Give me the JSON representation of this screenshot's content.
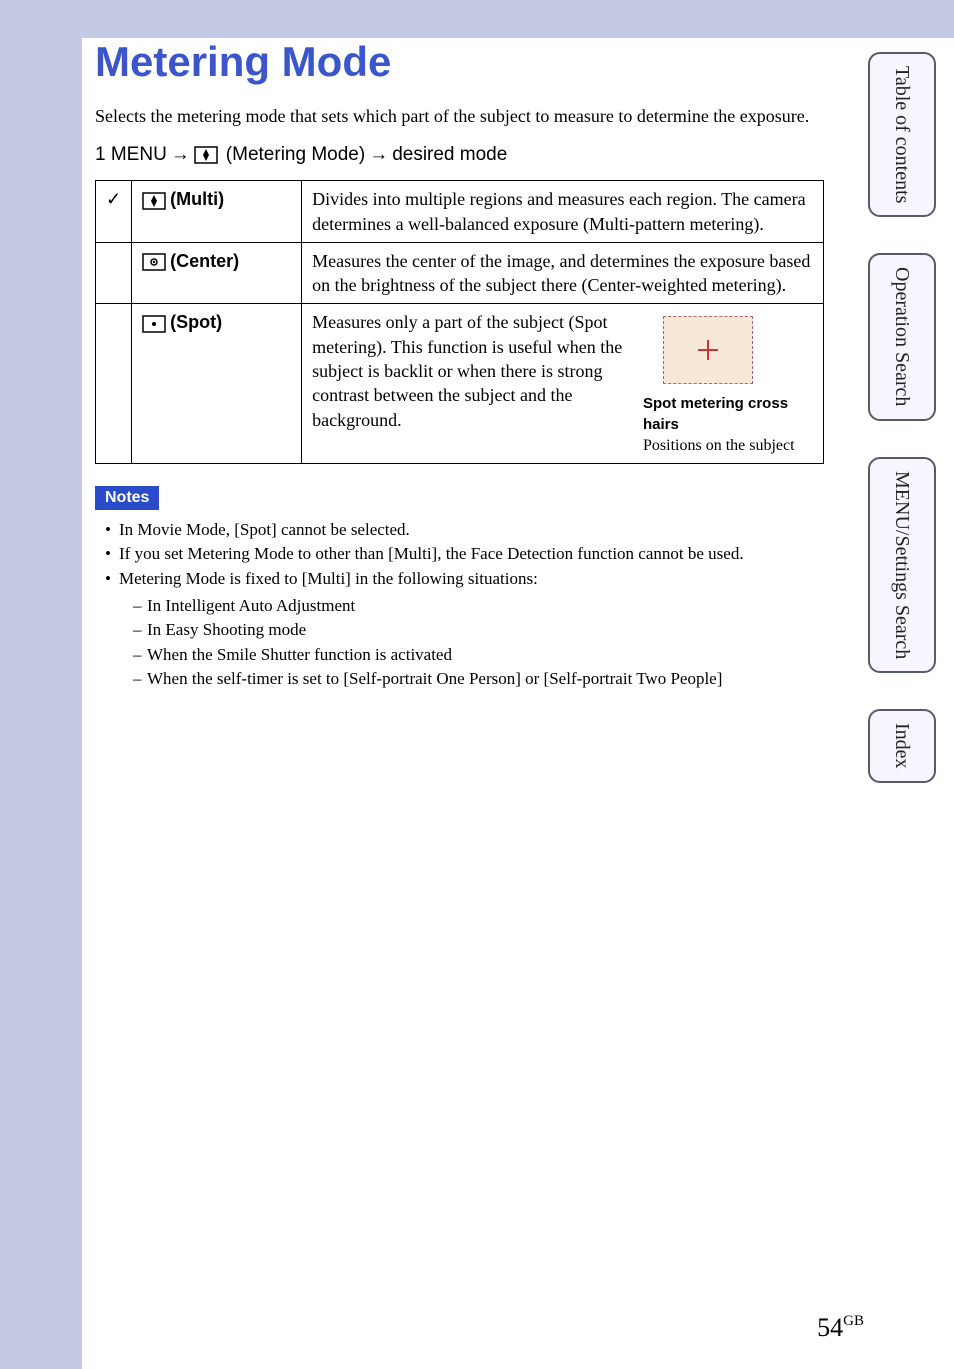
{
  "page": {
    "title": "Metering Mode",
    "intro": "Selects the metering mode that sets which part of the subject to measure to determine the exposure.",
    "instruction_prefix": "1  MENU",
    "instruction_mid": "(Metering Mode)",
    "instruction_suffix": "desired mode",
    "arrow": "→"
  },
  "table": {
    "rows": [
      {
        "check": "✓",
        "icon_name": "multi-icon",
        "label": "(Multi)",
        "desc": "Divides into multiple regions and measures each region. The camera determines a well-balanced exposure (Multi-pattern metering)."
      },
      {
        "check": "",
        "icon_name": "center-icon",
        "label": "(Center)",
        "desc": "Measures the center of the image, and determines the exposure based on the brightness of the subject there (Center-weighted metering)."
      },
      {
        "check": "",
        "icon_name": "spot-icon",
        "label": "(Spot)",
        "desc": "Measures only a part of the subject (Spot metering). This function is useful when the subject is backlit or when there is strong contrast between the subject and the background.",
        "caption_bold": "Spot metering cross hairs",
        "caption_normal": "Positions on the subject"
      }
    ]
  },
  "notes": {
    "heading": "Notes",
    "items": [
      "In Movie Mode, [Spot] cannot be selected.",
      "If you set Metering Mode to other than [Multi], the Face Detection function cannot be used.",
      "Metering Mode is fixed to [Multi] in the following situations:"
    ],
    "subitems": [
      "In Intelligent Auto Adjustment",
      "In Easy Shooting mode",
      "When the Smile Shutter function is activated",
      "When the self-timer is set to [Self-portrait One Person] or [Self-portrait Two People]"
    ]
  },
  "tabs": [
    "Table of contents",
    "Operation Search",
    "MENU/Settings Search",
    "Index"
  ],
  "page_number": "54",
  "page_lang": "GB"
}
